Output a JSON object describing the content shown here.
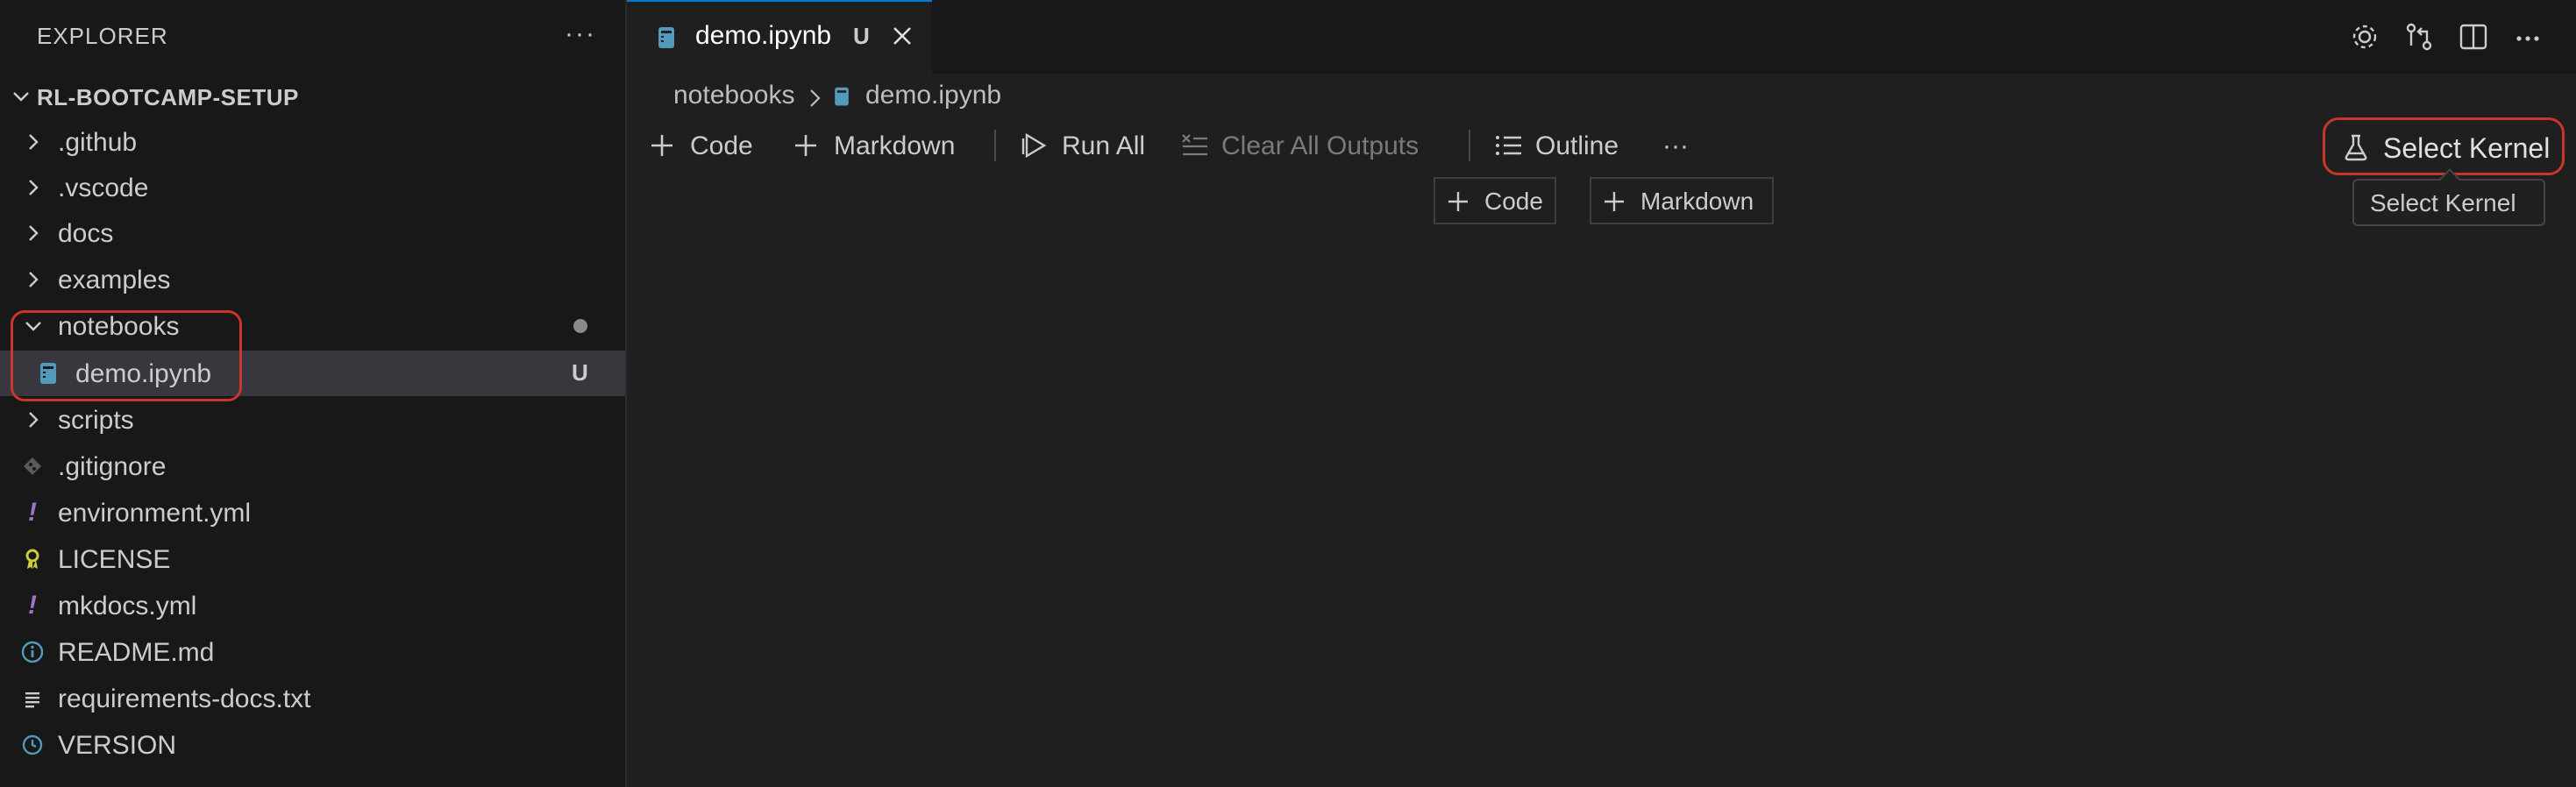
{
  "sidebar": {
    "title": "EXPLORER",
    "more": "···",
    "section": "RL-BOOTCAMP-SETUP",
    "items": [
      {
        "label": ".github",
        "kind": "folder"
      },
      {
        "label": ".vscode",
        "kind": "folder"
      },
      {
        "label": "docs",
        "kind": "folder"
      },
      {
        "label": "examples",
        "kind": "folder"
      },
      {
        "label": "notebooks",
        "kind": "folder-open"
      },
      {
        "label": "demo.ipynb",
        "kind": "notebook",
        "badge": "U"
      },
      {
        "label": "scripts",
        "kind": "folder"
      },
      {
        "label": ".gitignore",
        "kind": "git"
      },
      {
        "label": "environment.yml",
        "kind": "yaml"
      },
      {
        "label": "LICENSE",
        "kind": "license"
      },
      {
        "label": "mkdocs.yml",
        "kind": "yaml"
      },
      {
        "label": "README.md",
        "kind": "info"
      },
      {
        "label": "requirements-docs.txt",
        "kind": "text"
      },
      {
        "label": "VERSION",
        "kind": "version"
      }
    ]
  },
  "tab": {
    "label": "demo.ipynb",
    "badge": "U"
  },
  "breadcrumb": {
    "folder": "notebooks",
    "file": "demo.ipynb"
  },
  "toolbar": {
    "code": "Code",
    "markdown": "Markdown",
    "run_all": "Run All",
    "clear_outputs": "Clear All Outputs",
    "outline": "Outline",
    "more": "···",
    "select_kernel": "Select Kernel"
  },
  "cell_buttons": {
    "code": "Code",
    "markdown": "Markdown"
  },
  "tooltip": {
    "text": "Select Kernel"
  },
  "colors": {
    "background": "#1f1f1f",
    "sidebar": "#181818",
    "accent": "#0078d4",
    "highlight": "#c8352a",
    "yaml": "#a074c4",
    "notebook": "#519aba"
  }
}
